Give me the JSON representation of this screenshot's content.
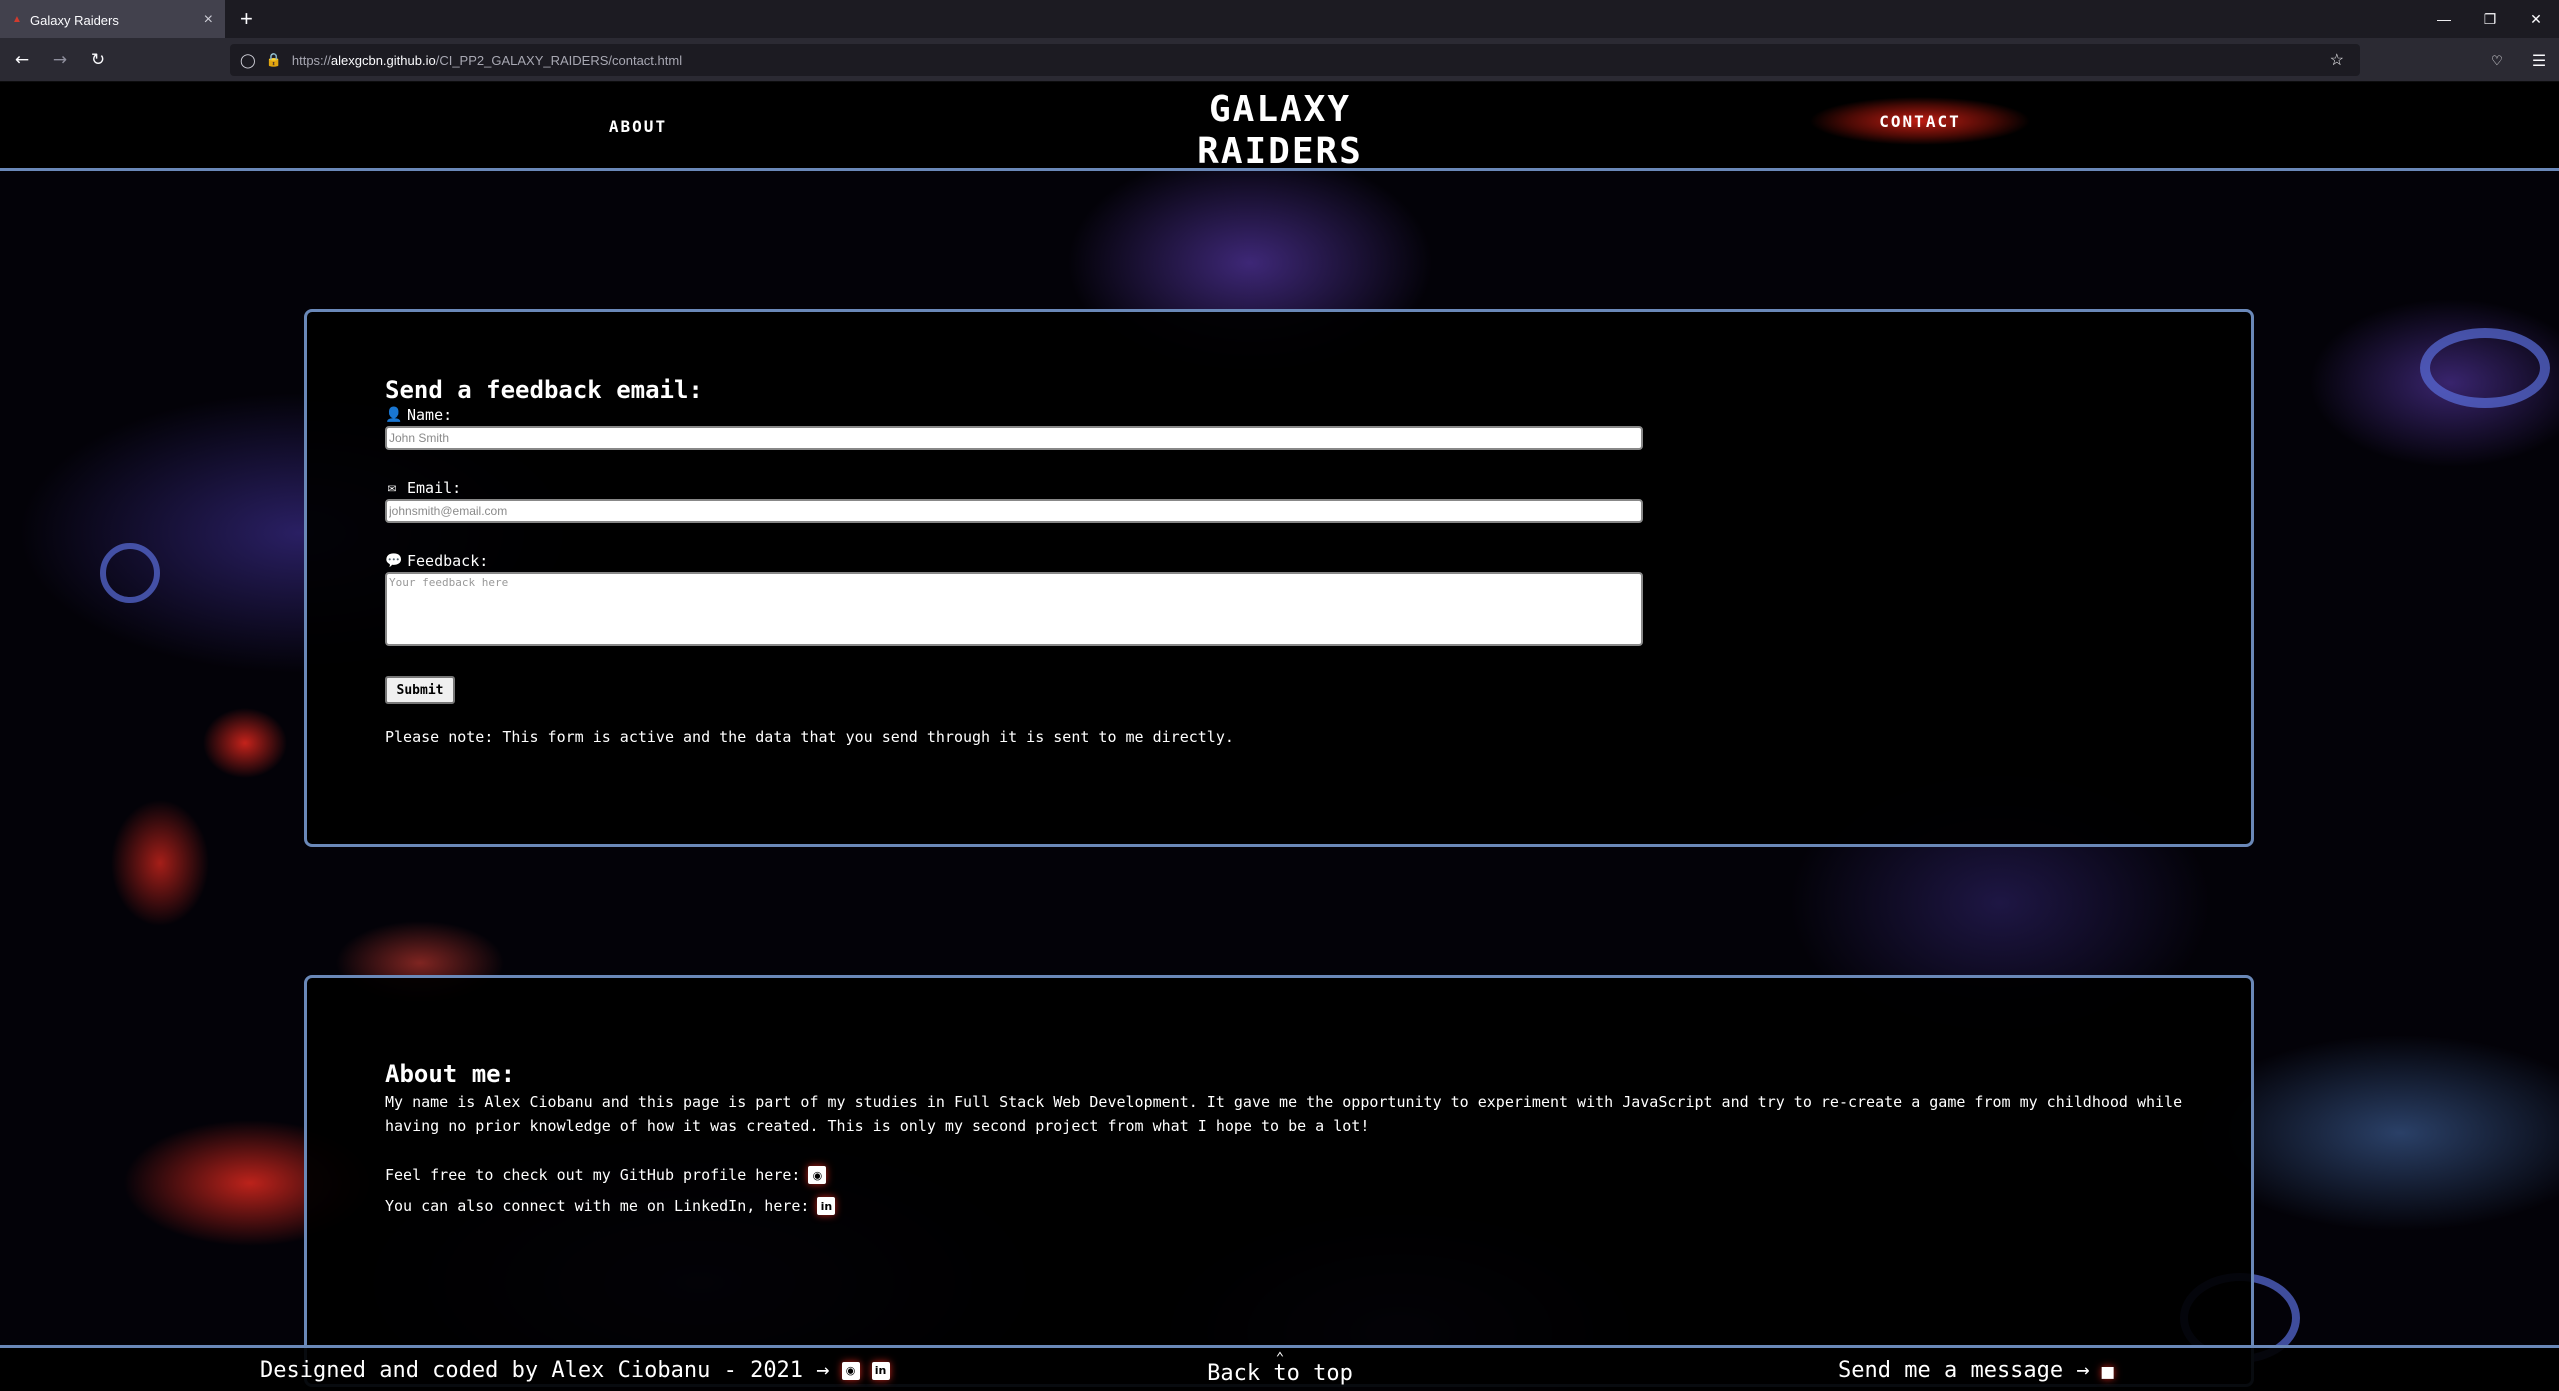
{
  "browser": {
    "tab_title": "Galaxy Raiders",
    "new_tab_label": "+",
    "url_scheme": "https://",
    "url_host": "alexgcbn.github.io",
    "url_path": "/CI_PP2_GALAXY_RAIDERS/contact.html"
  },
  "nav": {
    "about_label": "ABOUT",
    "logo_line1": "GALAXY",
    "logo_line2": "RAIDERS",
    "contact_label": "CONTACT"
  },
  "form": {
    "heading": "Send a feedback email:",
    "name_label": "Name:",
    "name_placeholder": "John Smith",
    "email_label": "Email:",
    "email_placeholder": "johnsmith@email.com",
    "feedback_label": "Feedback:",
    "feedback_placeholder": "Your feedback here",
    "submit_label": "Submit",
    "note": "Please note: This form is active and the data that you send through it is sent to me directly."
  },
  "about": {
    "heading": "About me:",
    "paragraph": "My name is Alex Ciobanu and this page is part of my studies in Full Stack Web Development. It gave me the opportunity to experiment with JavaScript and try to re-create a game from my childhood while having no prior knowledge of how it was created. This is only my second project from what I hope to be a lot!",
    "github_line": "Feel free to check out my GitHub profile here:",
    "linkedin_line": "You can also connect with me on LinkedIn, here:"
  },
  "footer": {
    "credit": "Designed and coded by Alex Ciobanu - 2021 →",
    "back_to_top": "Back to top",
    "send_message": "Send me a message →"
  },
  "icons": {
    "name": "user-icon",
    "email": "envelope-icon",
    "feedback": "comment-icon",
    "github": "github-icon",
    "linkedin": "linkedin-icon",
    "message": "chat-icon"
  },
  "colors": {
    "accent_border": "#6a88b8",
    "contact_glow": "#c81e14"
  }
}
